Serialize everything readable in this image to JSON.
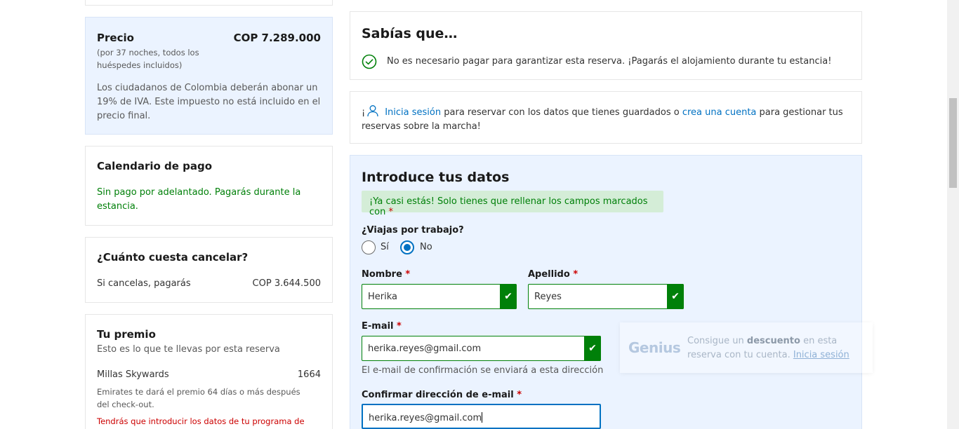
{
  "price": {
    "title": "Precio",
    "value": "COP 7.289.000",
    "subtitle": "(por 37 noches, todos los huéspedes incluidos)",
    "tax_note": "Los ciudadanos de Colombia deberán abonar un 19% de IVA. Este impuesto no está incluido en el precio final."
  },
  "calendar": {
    "title": "Calendario de pago",
    "text": "Sin pago por adelantado. Pagarás durante la estancia."
  },
  "cancel": {
    "title": "¿Cuánto cuesta cancelar?",
    "label": "Si cancelas, pagarás",
    "value": "COP 3.644.500"
  },
  "reward": {
    "title": "Tu premio",
    "subtitle": "Esto es lo que te llevas por esta reserva",
    "item": "Millas Skywards",
    "item_value": "1664",
    "note": "Emirates te dará el premio 64 días o más después del check-out.",
    "warning": "Tendrás que introducir los datos de tu programa de"
  },
  "know": {
    "title": "Sabías que…",
    "text": "No es necesario pagar para garantizar esta reserva. ¡Pagarás el alojamiento durante tu estancia!"
  },
  "login": {
    "prefix": "¡",
    "signin_link": "Inicia sesión",
    "middle": " para reservar con los datos que tienes guardados o ",
    "create_link": "crea una cuenta",
    "suffix": " para gestionar tus reservas sobre la marcha!"
  },
  "form": {
    "title": "Introduce tus datos",
    "alert": "¡Ya casi estás! Solo tienes que rellenar los campos marcados con ",
    "required_mark": "*",
    "trip_question": "¿Viajas por trabajo?",
    "option_yes": "Sí",
    "option_no": "No",
    "selected_option": "No",
    "first_name_label": "Nombre ",
    "first_name_value": "Herika",
    "last_name_label": "Apellido ",
    "last_name_value": "Reyes",
    "email_label": "E-mail ",
    "email_value": "herika.reyes@gmail.com",
    "email_help": "El e-mail de confirmación se enviará a esta dirección",
    "confirm_label": "Confirmar dirección de e-mail ",
    "confirm_value": "herika.reyes@gmail.com",
    "check_mark": "✔"
  },
  "genius": {
    "logo": "Genius",
    "text_before": "Consigue un ",
    "text_bold": "descuento",
    "text_after": " en esta reserva con tu cuenta. ",
    "link": "Inicia sesión"
  },
  "colors": {
    "accent": "#0071c2",
    "success": "#008009",
    "required": "#cc0000",
    "panel_blue": "#ebf3ff"
  }
}
